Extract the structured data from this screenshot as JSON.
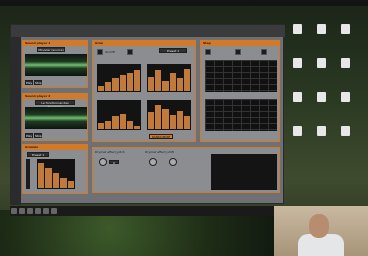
{
  "sound_player_1": {
    "title": "Sound player 1",
    "file": "Mouvlar (source)",
    "play": "Play",
    "stop": "Stop"
  },
  "sound_player_2": {
    "title": "Sound player 2",
    "file": "Le fonctionnel des diversions",
    "play": "Play",
    "stop": "Stop"
  },
  "effect_panel": {
    "title": "Granule",
    "preset": "Preset 1"
  },
  "granulator": {
    "title": "Gran",
    "enable_label": "On/Off",
    "mode": "Preset 1",
    "graph1_label": "",
    "graph2_label": "",
    "graph3_label": "",
    "graph4_label": "",
    "randomize": "RANDOMIZE"
  },
  "sequencer": {
    "title": "Step"
  },
  "bottom_effects": {
    "pitch_label": "Drymet effect_pitch",
    "pitch_value": "0",
    "shift_label": "Drymet effect_shift"
  }
}
